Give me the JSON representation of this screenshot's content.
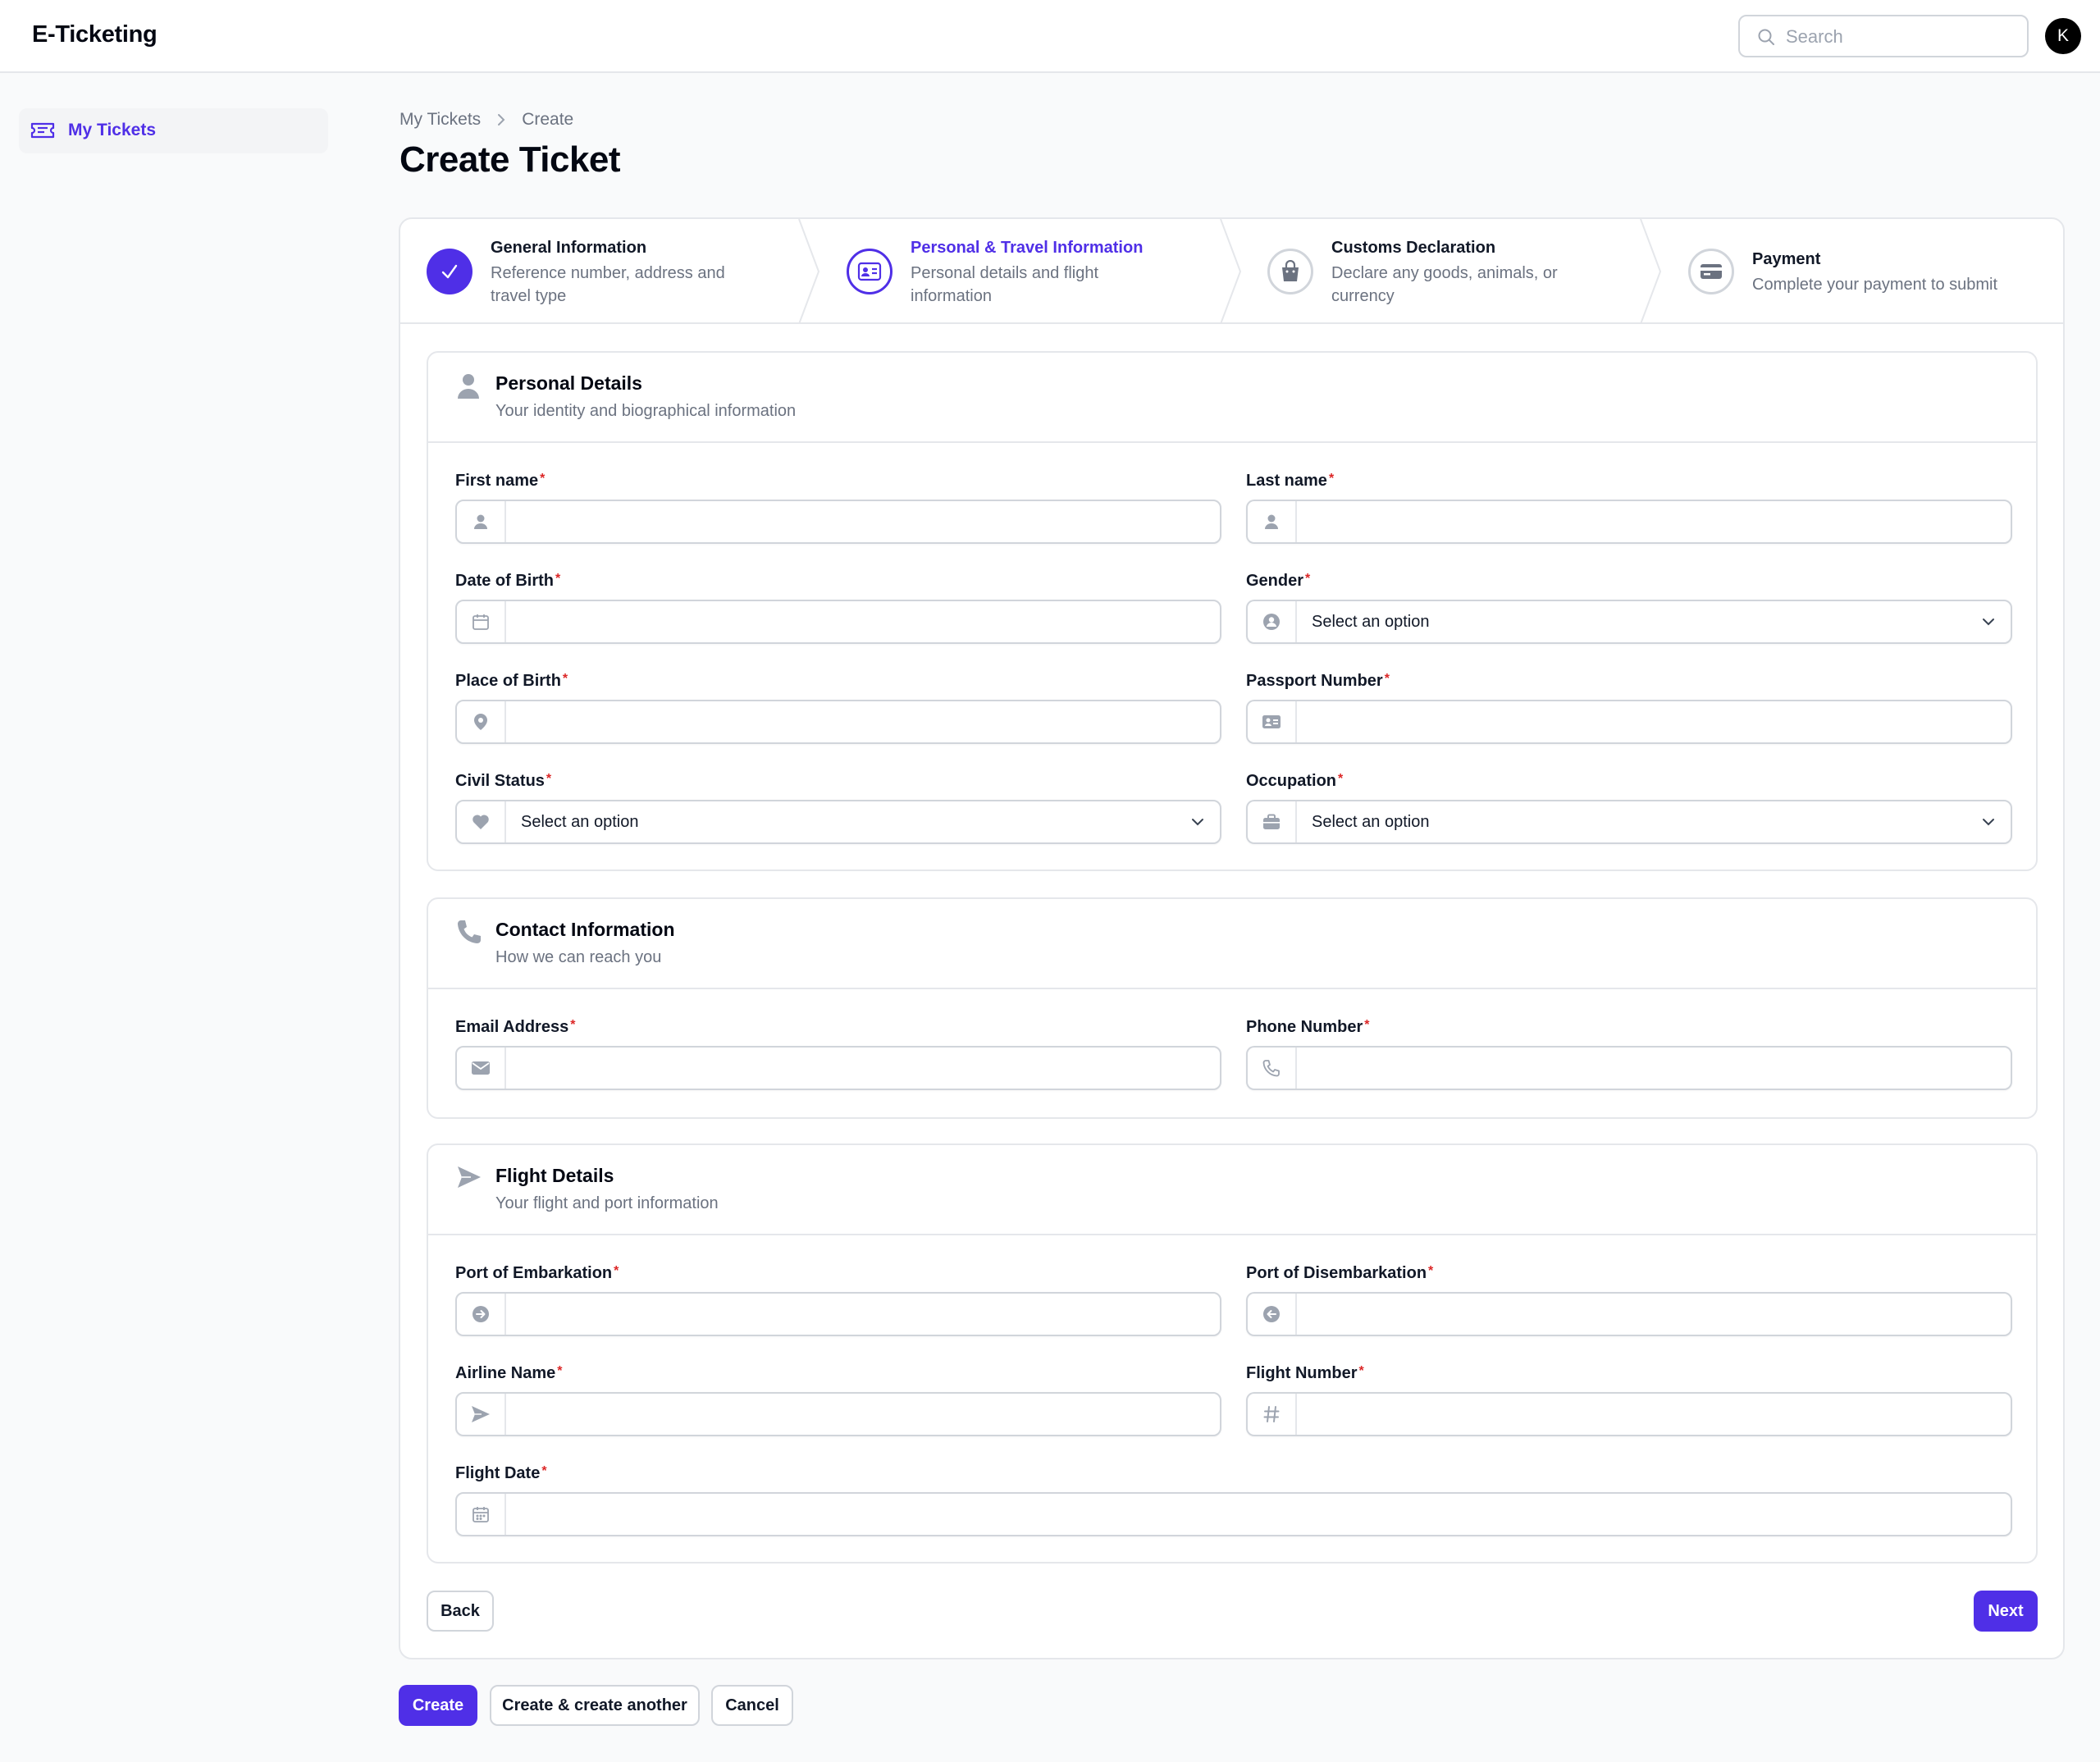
{
  "app": {
    "title": "E-Ticketing",
    "avatar_initial": "K"
  },
  "search": {
    "placeholder": "Search"
  },
  "sidebar": {
    "items": [
      {
        "label": "My Tickets",
        "icon": "ticket-icon",
        "active": true
      }
    ]
  },
  "breadcrumb": {
    "items": [
      "My Tickets",
      "Create"
    ]
  },
  "page": {
    "title": "Create Ticket"
  },
  "steps": [
    {
      "title": "General Information",
      "description": "Reference number, address and travel type",
      "state": "completed",
      "icon": "check-icon"
    },
    {
      "title": "Personal & Travel Information",
      "description": "Personal details and flight information",
      "state": "current",
      "icon": "id-card-icon"
    },
    {
      "title": "Customs Declaration",
      "description": "Declare any goods, animals, or currency",
      "state": "upcoming",
      "icon": "shopping-bag-icon"
    },
    {
      "title": "Payment",
      "description": "Complete your payment to submit",
      "state": "upcoming",
      "icon": "credit-card-icon"
    }
  ],
  "sections": {
    "personal": {
      "title": "Personal Details",
      "subtitle": "Your identity and biographical information",
      "icon": "user-icon",
      "fields": {
        "first_name": {
          "label": "First name"
        },
        "last_name": {
          "label": "Last name"
        },
        "dob": {
          "label": "Date of Birth"
        },
        "gender": {
          "label": "Gender",
          "value": "Select an option"
        },
        "pob": {
          "label": "Place of Birth"
        },
        "passport": {
          "label": "Passport Number"
        },
        "civil": {
          "label": "Civil Status",
          "value": "Select an option"
        },
        "occupation": {
          "label": "Occupation",
          "value": "Select an option"
        }
      }
    },
    "contact": {
      "title": "Contact Information",
      "subtitle": "How we can reach you",
      "icon": "phone-icon",
      "fields": {
        "email": {
          "label": "Email Address"
        },
        "phone": {
          "label": "Phone Number"
        }
      }
    },
    "flight": {
      "title": "Flight Details",
      "subtitle": "Your flight and port information",
      "icon": "paper-plane-icon",
      "fields": {
        "embark": {
          "label": "Port of Embarkation"
        },
        "disembark": {
          "label": "Port of Disembarkation"
        },
        "airline": {
          "label": "Airline Name"
        },
        "flight_no": {
          "label": "Flight Number"
        },
        "flight_date": {
          "label": "Flight Date"
        }
      }
    }
  },
  "wizard_actions": {
    "back": "Back",
    "next": "Next"
  },
  "form_actions": {
    "create": "Create",
    "create_another": "Create & create another",
    "cancel": "Cancel"
  },
  "required_marker": "*",
  "colors": {
    "primary": "#4f2fe7",
    "required": "#dc2626",
    "muted_text": "#6b7280",
    "border": "#d1d5db"
  }
}
